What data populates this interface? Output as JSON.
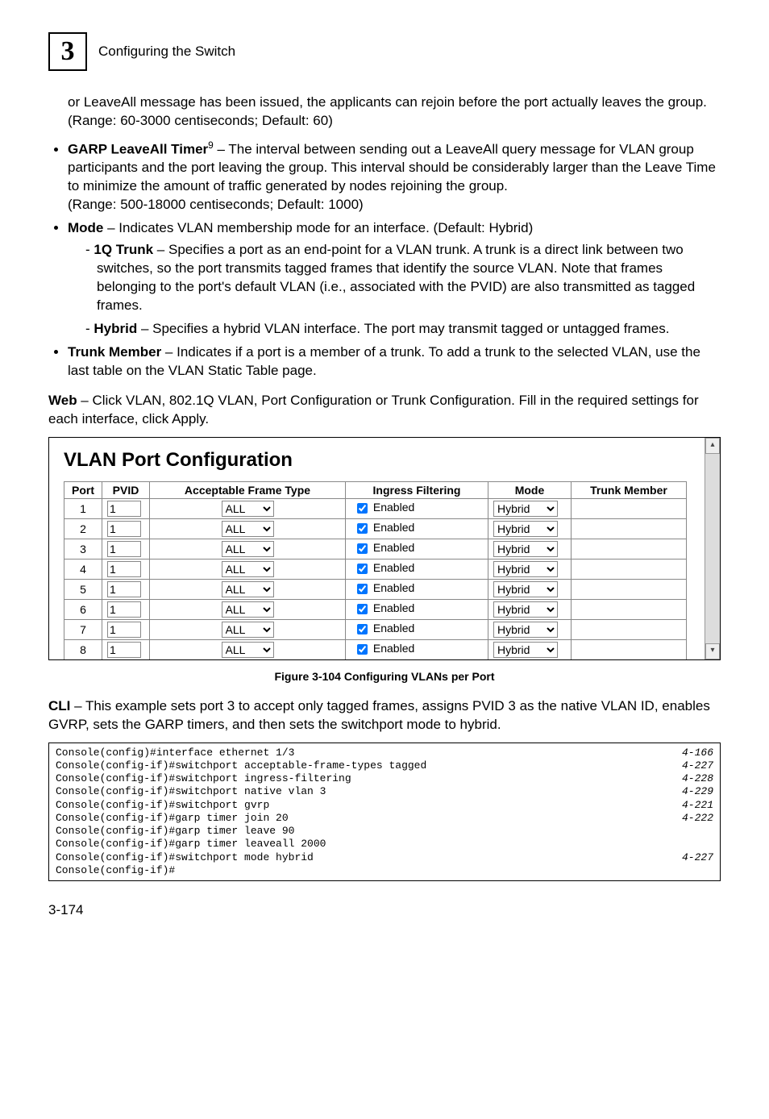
{
  "header": {
    "chapterNumber": "3",
    "chapterTitle": "Configuring the Switch"
  },
  "introPara": "or LeaveAll message has been issued, the applicants can rejoin before the port actually leaves the group. (Range: 60-3000 centiseconds; Default: 60)",
  "bullets": {
    "garp": {
      "term": "GARP LeaveAll Timer",
      "sup": "9",
      "after": "  – The interval between sending out a LeaveAll query message for VLAN group participants and the port leaving the group. This interval should be considerably larger than the Leave Time to minimize the amount of traffic generated by nodes rejoining the group.",
      "range": "(Range: 500-18000 centiseconds; Default: 1000)"
    },
    "mode": {
      "term": "Mode",
      "after": " – Indicates VLAN membership mode for an interface. (Default: Hybrid)",
      "sub": {
        "oneq": {
          "term": "1Q Trunk",
          "after": " – Specifies a port as an end-point for a VLAN trunk. A trunk is a direct link between two switches, so the port transmits tagged frames that identify the source VLAN. Note that frames belonging to the port's default VLAN (i.e., associated with the PVID) are also transmitted as tagged frames."
        },
        "hybrid": {
          "term": "Hybrid",
          "after": " – Specifies a hybrid VLAN interface. The port may transmit tagged or untagged frames."
        }
      }
    },
    "trunkMember": {
      "term": "Trunk Member",
      "after": " – Indicates if a port is a member of a trunk. To add a trunk to the selected VLAN, use the last table on the VLAN Static Table page."
    }
  },
  "webPara": {
    "lead": "Web",
    "rest": " – Click VLAN, 802.1Q VLAN, Port Configuration or Trunk Configuration. Fill in the required settings for each interface, click Apply."
  },
  "panel": {
    "title": "VLAN Port Configuration",
    "headers": {
      "port": "Port",
      "pvid": "PVID",
      "aft": "Acceptable Frame Type",
      "ing": "Ingress Filtering",
      "mode": "Mode",
      "trunk": "Trunk Member"
    },
    "rows": [
      {
        "port": "1",
        "pvid": "1",
        "aft": "ALL",
        "ingChecked": true,
        "ingLabel": "Enabled",
        "mode": "Hybrid"
      },
      {
        "port": "2",
        "pvid": "1",
        "aft": "ALL",
        "ingChecked": true,
        "ingLabel": "Enabled",
        "mode": "Hybrid"
      },
      {
        "port": "3",
        "pvid": "1",
        "aft": "ALL",
        "ingChecked": true,
        "ingLabel": "Enabled",
        "mode": "Hybrid"
      },
      {
        "port": "4",
        "pvid": "1",
        "aft": "ALL",
        "ingChecked": true,
        "ingLabel": "Enabled",
        "mode": "Hybrid"
      },
      {
        "port": "5",
        "pvid": "1",
        "aft": "ALL",
        "ingChecked": true,
        "ingLabel": "Enabled",
        "mode": "Hybrid"
      },
      {
        "port": "6",
        "pvid": "1",
        "aft": "ALL",
        "ingChecked": true,
        "ingLabel": "Enabled",
        "mode": "Hybrid"
      },
      {
        "port": "7",
        "pvid": "1",
        "aft": "ALL",
        "ingChecked": true,
        "ingLabel": "Enabled",
        "mode": "Hybrid"
      },
      {
        "port": "8",
        "pvid": "1",
        "aft": "ALL",
        "ingChecked": true,
        "ingLabel": "Enabled",
        "mode": "Hybrid"
      }
    ]
  },
  "figureCaption": "Figure 3-104  Configuring VLANs per Port",
  "cliPara": {
    "lead": "CLI",
    "rest": " – This example sets port 3 to accept only tagged frames, assigns PVID 3 as the native VLAN ID, enables GVRP, sets the GARP timers, and then sets the switchport mode to hybrid."
  },
  "cliLines": [
    {
      "cmd": "Console(config)#interface ethernet 1/3",
      "ref": "4-166"
    },
    {
      "cmd": "Console(config-if)#switchport acceptable-frame-types tagged",
      "ref": "4-227"
    },
    {
      "cmd": "Console(config-if)#switchport ingress-filtering",
      "ref": "4-228"
    },
    {
      "cmd": "Console(config-if)#switchport native vlan 3",
      "ref": "4-229"
    },
    {
      "cmd": "Console(config-if)#switchport gvrp",
      "ref": "4-221"
    },
    {
      "cmd": "Console(config-if)#garp timer join 20",
      "ref": "4-222"
    },
    {
      "cmd": "Console(config-if)#garp timer leave 90",
      "ref": ""
    },
    {
      "cmd": "Console(config-if)#garp timer leaveall 2000",
      "ref": ""
    },
    {
      "cmd": "Console(config-if)#switchport mode hybrid",
      "ref": "4-227"
    },
    {
      "cmd": "Console(config-if)#",
      "ref": ""
    }
  ],
  "pageNumber": "3-174"
}
